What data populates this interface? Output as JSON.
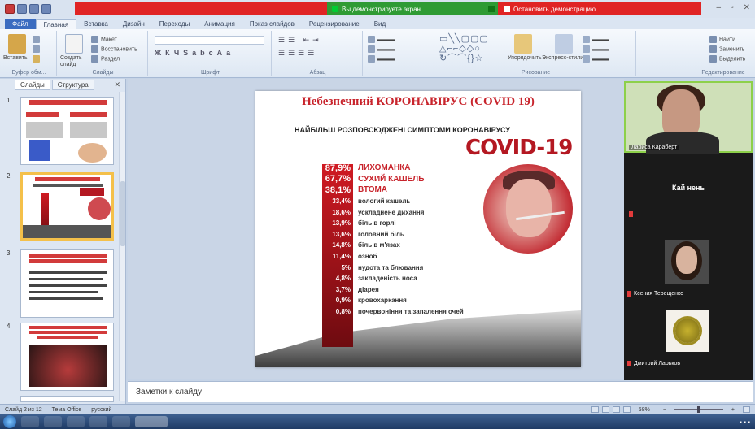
{
  "window": {
    "share_status": "Вы демонстрируете экран",
    "stop_share_label": "Остановить демонстрацию"
  },
  "tabs": [
    {
      "label": "Файл"
    },
    {
      "label": "Главная"
    },
    {
      "label": "Вставка"
    },
    {
      "label": "Дизайн"
    },
    {
      "label": "Переходы"
    },
    {
      "label": "Анимация"
    },
    {
      "label": "Показ слайдов"
    },
    {
      "label": "Рецензирование"
    },
    {
      "label": "Вид"
    }
  ],
  "ribbon": {
    "clipboard": {
      "paste_label": "Вставить",
      "group_label": "Буфер обм..."
    },
    "slides": {
      "create_label": "Создать слайд",
      "layout_label": "Макет",
      "reset_label": "Восстановить",
      "section_label": "Раздел",
      "group_label": "Слайды"
    },
    "font": {
      "group_label": "Шрифт"
    },
    "paragraph": {
      "group_label": "Абзац"
    },
    "drawing": {
      "arrange_label": "Упорядочить",
      "quick_styles_label": "Экспресс-стили",
      "group_label": "Рисование"
    },
    "editing": {
      "find_label": "Найти",
      "replace_label": "Заменить",
      "select_label": "Выделить",
      "group_label": "Редактирование"
    }
  },
  "left_panel": {
    "tabs": [
      {
        "label": "Слайды"
      },
      {
        "label": "Структура"
      }
    ],
    "slide_numbers": [
      "1",
      "2",
      "3",
      "4"
    ]
  },
  "slide": {
    "title": "Небезпечний КОРОНАВІРУС (COVID 19)",
    "subtitle": "НАЙБІЛЬШ РОЗПОВСЮДЖЕНІ СИМПТОМИ КОРОНАВІРУСУ",
    "covid_label": "COVID-19",
    "symptoms": [
      {
        "value": "87,9%",
        "name": "ЛИХОМАНКА",
        "top": true
      },
      {
        "value": "67,7%",
        "name": "СУХИЙ КАШЕЛЬ",
        "top": true
      },
      {
        "value": "38,1%",
        "name": "ВТОМА",
        "top": true
      },
      {
        "value": "33,4%",
        "name": "вологий кашель",
        "top": false
      },
      {
        "value": "18,6%",
        "name": "ускладнене дихання",
        "top": false
      },
      {
        "value": "13,9%",
        "name": "біль в горлі",
        "top": false
      },
      {
        "value": "13,6%",
        "name": "головний біль",
        "top": false
      },
      {
        "value": "14,8%",
        "name": "біль в м'язах",
        "top": false
      },
      {
        "value": "11,4%",
        "name": "озноб",
        "top": false
      },
      {
        "value": "5%",
        "name": "нудота та блювання",
        "top": false
      },
      {
        "value": "4,8%",
        "name": "закладеність носа",
        "top": false
      },
      {
        "value": "3,7%",
        "name": "діарея",
        "top": false
      },
      {
        "value": "0,9%",
        "name": "кровохаркання",
        "top": false
      },
      {
        "value": "0,8%",
        "name": "почервоніння та запалення очей",
        "top": false
      }
    ]
  },
  "notes": {
    "placeholder": "Заметки к слайду"
  },
  "video_panel": {
    "participants": [
      {
        "name": "Лариса Караберт"
      },
      {
        "name": "Кай нень"
      },
      {
        "name": "Ксения Терещенко"
      },
      {
        "name": "Дмитрий Ларьков"
      }
    ]
  },
  "status_bar": {
    "slide_info": "Слайд 2 из 12",
    "theme": "Тема Office",
    "language": "русский",
    "zoom": "58%"
  }
}
